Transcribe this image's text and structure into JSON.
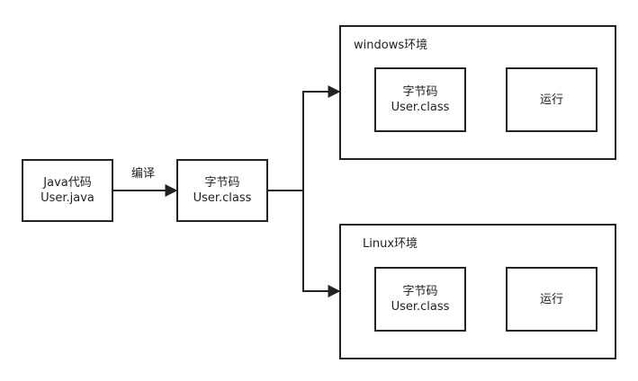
{
  "diagram": {
    "source_box": {
      "line1": "Java代码",
      "line2": "User.java"
    },
    "compile_label": "编译",
    "bytecode_box": {
      "line1": "字节码",
      "line2": "User.class"
    },
    "windows_env": {
      "label": "windows环境",
      "bytecode": {
        "line1": "字节码",
        "line2": "User.class"
      },
      "run": "运行"
    },
    "linux_env": {
      "label": "Linux环境",
      "bytecode": {
        "line1": "字节码",
        "line2": "User.class"
      },
      "run": "运行"
    },
    "colors": {
      "stroke": "#222222",
      "background": "#ffffff"
    }
  }
}
